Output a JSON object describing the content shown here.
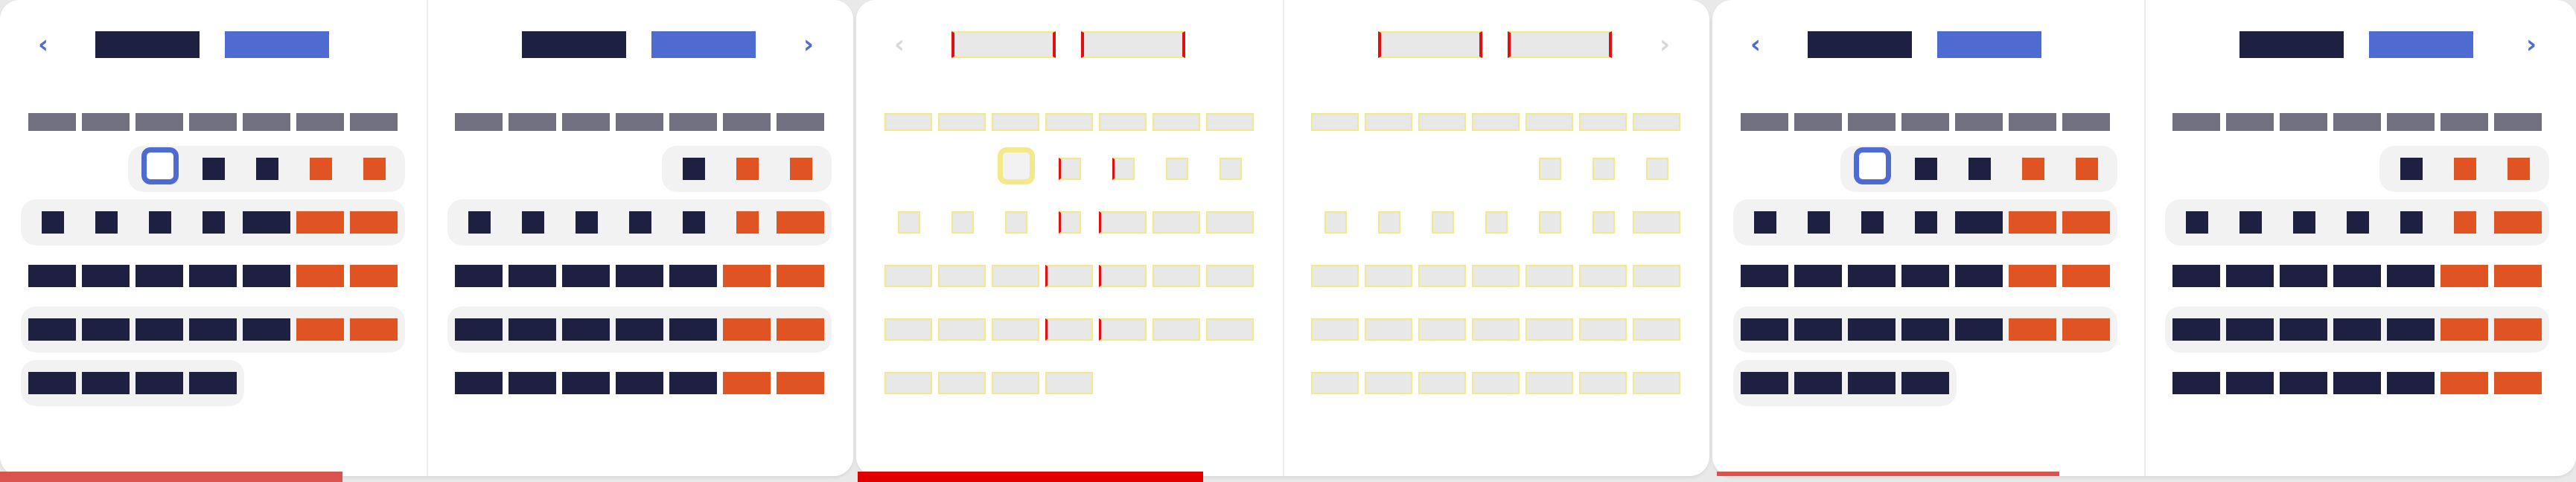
{
  "colors": {
    "dark": "#1d2040",
    "blue": "#4e6bd1",
    "orange": "#e05423",
    "gray": "#707080",
    "ghost": "#e8e8e8",
    "ghost_border": "#f3e88a",
    "red_marker": "#e01010",
    "row_bg": "#f2f2f3",
    "bottom_red": "#d9534f",
    "bottom_strong_red": "#e00000"
  },
  "panels": [
    {
      "kind": "solid",
      "prev": "‹",
      "next": "",
      "variant": "A"
    },
    {
      "kind": "solid",
      "prev": "",
      "next": "›",
      "variant": "B"
    },
    {
      "kind": "ghost",
      "prev": "‹",
      "next": "",
      "variant": "A"
    },
    {
      "kind": "ghost",
      "prev": "",
      "next": "›",
      "variant": "B"
    },
    {
      "kind": "solid",
      "prev": "‹",
      "next": "",
      "variant": "A"
    },
    {
      "kind": "solid",
      "prev": "",
      "next": "›",
      "variant": "B"
    }
  ],
  "icons": {
    "prev": "chevron-left-icon",
    "next": "chevron-right-icon"
  }
}
